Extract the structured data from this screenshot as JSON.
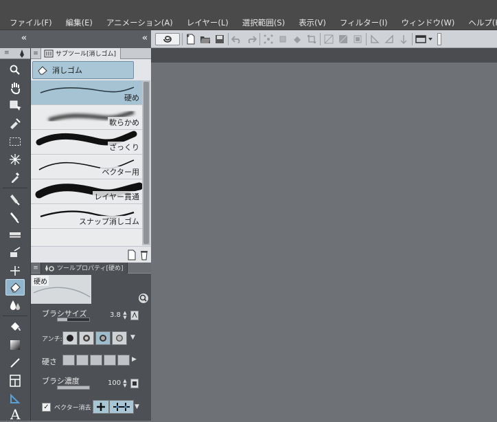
{
  "menu": {
    "items": [
      "ファイル(F)",
      "編集(E)",
      "アニメーション(A)",
      "レイヤー(L)",
      "選択範囲(S)",
      "表示(V)",
      "フィルター(I)",
      "ウィンドウ(W)",
      "ヘルプ(H)"
    ]
  },
  "toolbar": {
    "collapse_left": "«",
    "collapse_mid": "«"
  },
  "subtool_panel": {
    "tab_title": "サブツール[消しゴム]",
    "group_label": "消しゴム",
    "brushes": [
      {
        "label": "硬め",
        "selected": true
      },
      {
        "label": "軟らかめ",
        "selected": false
      },
      {
        "label": "ざっくり",
        "selected": false
      },
      {
        "label": "ベクター用",
        "selected": false
      },
      {
        "label": "レイヤー貫通",
        "selected": false
      },
      {
        "label": "スナップ消しゴム",
        "selected": false
      }
    ]
  },
  "tool_property": {
    "tab_title": "ツールプロパティ[硬め]",
    "preview_label": "硬め",
    "brush_size_label": "ブラシサイズ",
    "brush_size_value": "3.8",
    "antialias_label": "アンチ:",
    "hardness_label": "硬さ",
    "density_label": "ブラシ濃度",
    "density_value": "100",
    "vector_erase_label": "ベクター消去",
    "vector_erase_checked": "✓"
  },
  "colors": {
    "menubar_bg": "#4a4a4a",
    "panel_dark": "#4d5054",
    "canvas_bg": "#6e7176",
    "selected_accent": "#a6c3d3"
  }
}
